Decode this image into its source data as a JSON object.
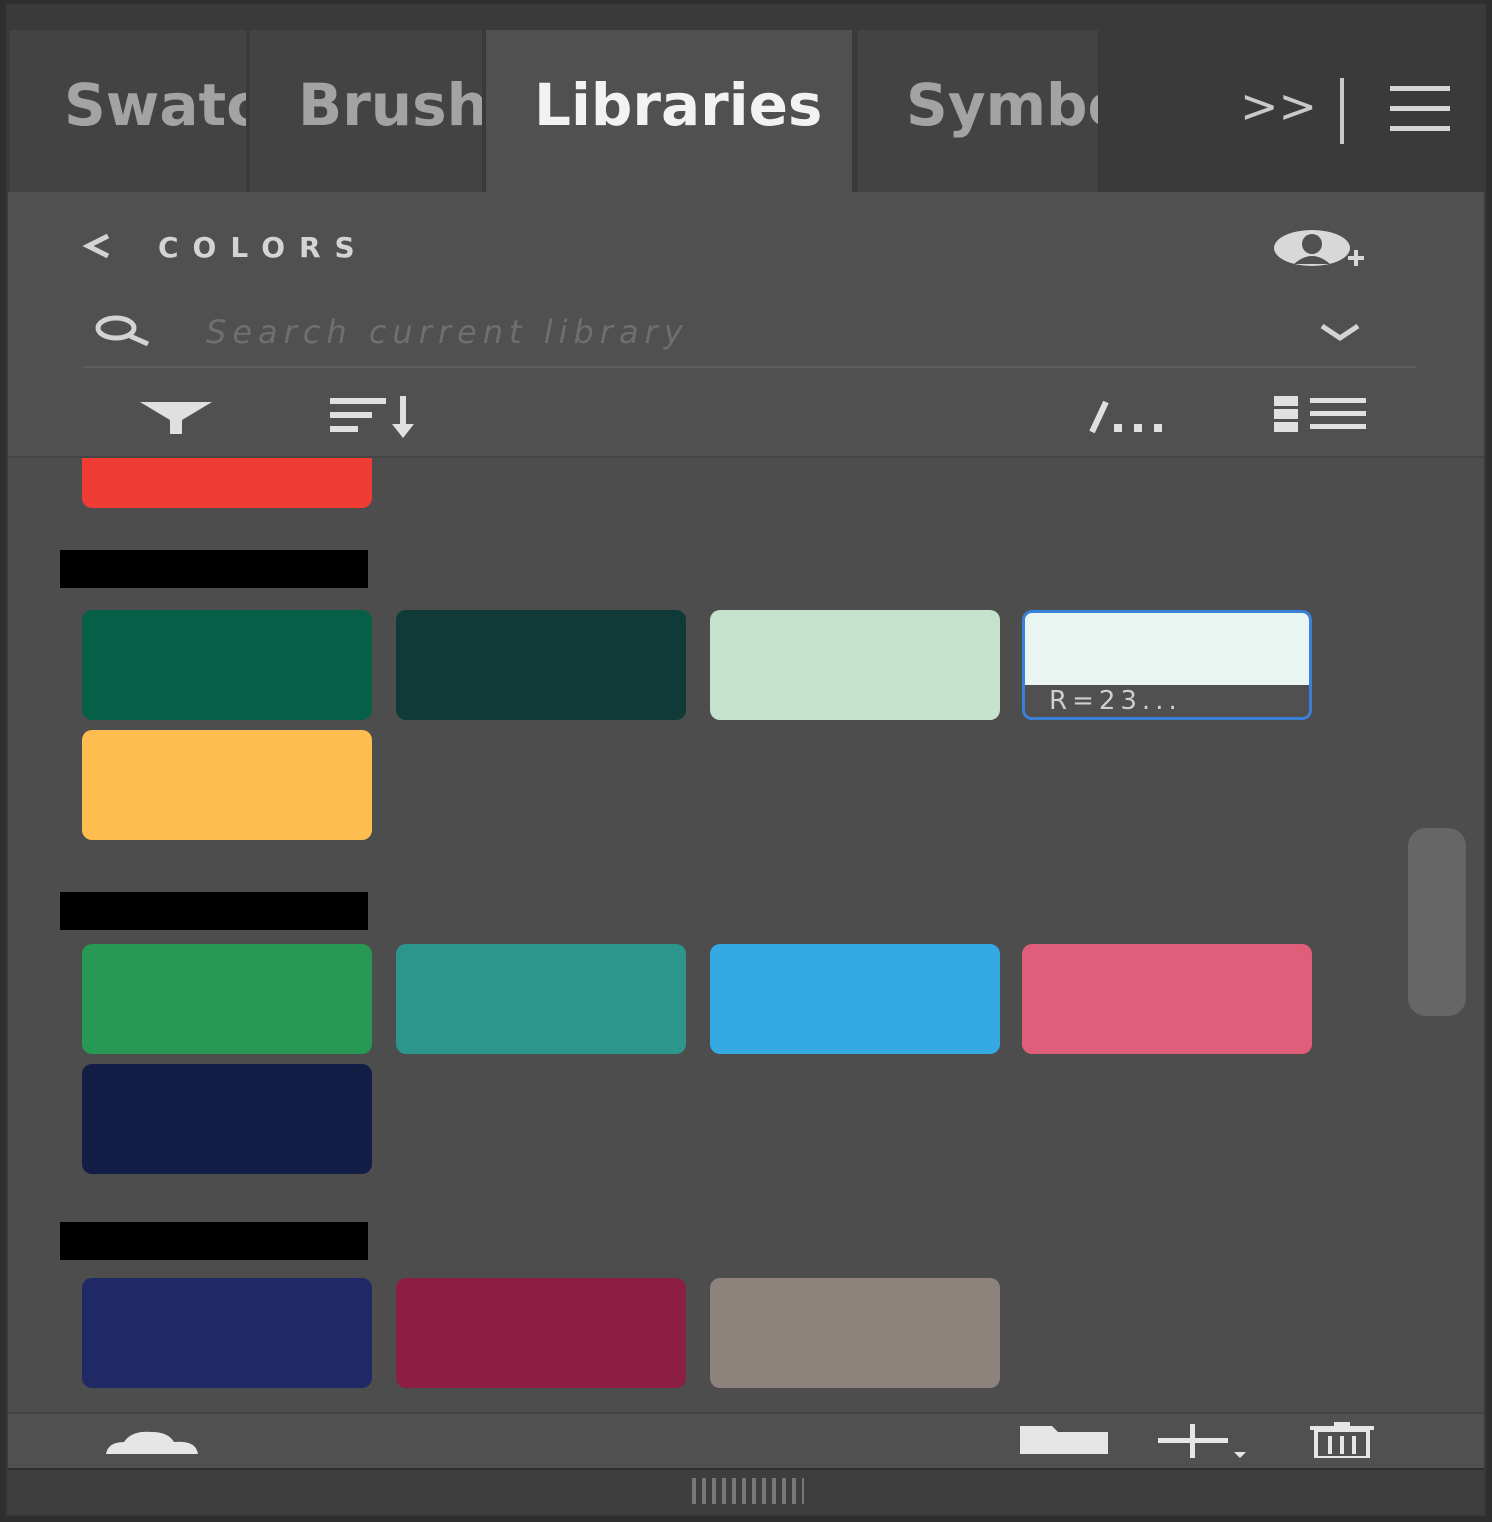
{
  "tabs": [
    {
      "label": "Swatches",
      "active": false
    },
    {
      "label": "Brushes",
      "active": false
    },
    {
      "label": "Libraries",
      "active": true
    },
    {
      "label": "Symbols",
      "active": false
    }
  ],
  "tab_overflow_label": ">>",
  "header": {
    "back_label": "<",
    "section_title": "COLORS"
  },
  "search": {
    "placeholder": "Search current library"
  },
  "icons": {
    "back": "chevron-left-icon",
    "invite": "add-user-icon",
    "search": "search-icon",
    "dropdown": "chevron-down-icon",
    "filter": "filter-icon",
    "sort": "sort-icon",
    "edit": "edit-icon",
    "view": "list-view-icon",
    "menu": "hamburger-menu-icon",
    "cloud": "cloud-icon",
    "folder": "folder-icon",
    "add": "add-icon",
    "trash": "trash-icon"
  },
  "groups": [
    {
      "swatches": [
        {
          "color": "#ef3c34"
        }
      ]
    },
    {
      "swatches": [
        {
          "color": "#066048"
        },
        {
          "color": "#0f3a38"
        },
        {
          "color": "#c5e2cd"
        },
        {
          "color": "#e9f5f0",
          "label": "R=23...",
          "selected": true
        },
        {
          "color": "#febd4f"
        }
      ]
    },
    {
      "swatches": [
        {
          "color": "#279955"
        },
        {
          "color": "#2d968c"
        },
        {
          "color": "#35a9e2"
        },
        {
          "color": "#df5f7b"
        },
        {
          "color": "#121e45"
        }
      ]
    },
    {
      "swatches": [
        {
          "color": "#1f2966"
        },
        {
          "color": "#8d1e43"
        },
        {
          "color": "#8d837c"
        }
      ]
    }
  ]
}
